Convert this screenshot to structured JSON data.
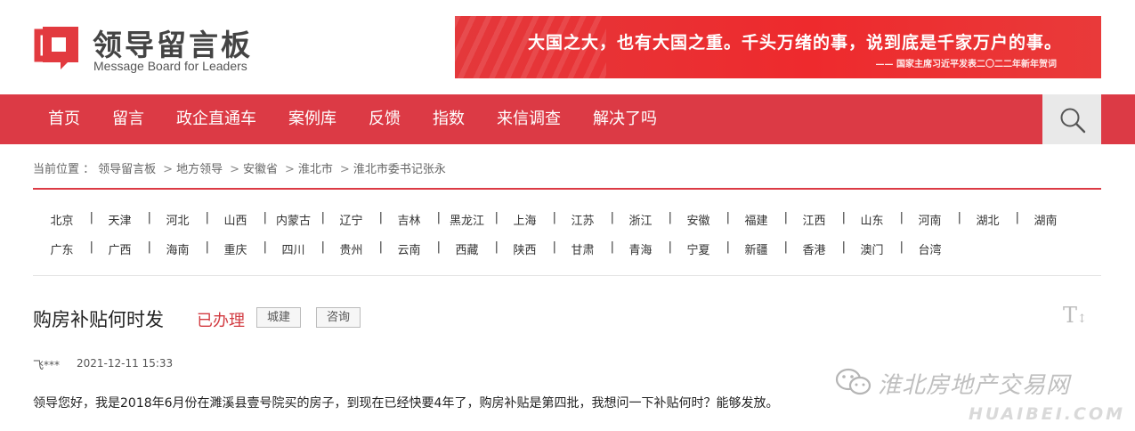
{
  "header": {
    "logo_title": "领导留言板",
    "logo_subtitle": "Message Board for Leaders",
    "banner_main": "大国之大，也有大国之重。千头万绪的事，说到底是千家万户的事。",
    "banner_sub": "—— 国家主席习近平发表二〇二二年新年贺词",
    "brand_color": "#dc3a45"
  },
  "nav": {
    "items": [
      "首页",
      "留言",
      "政企直通车",
      "案例库",
      "反馈",
      "指数",
      "来信调查",
      "解决了吗"
    ],
    "search_icon": "search-icon"
  },
  "breadcrumb": {
    "prefix": "当前位置 ：",
    "items": [
      "领导留言板",
      "地方领导",
      "安徽省",
      "淮北市",
      "淮北市委书记张永"
    ]
  },
  "regions": {
    "row1": [
      "北京",
      "天津",
      "河北",
      "山西",
      "内蒙古",
      "辽宁",
      "吉林",
      "黑龙江",
      "上海",
      "江苏",
      "浙江",
      "安徽",
      "福建",
      "江西",
      "山东",
      "河南",
      "湖北",
      "湖南"
    ],
    "row2": [
      "广东",
      "广西",
      "海南",
      "重庆",
      "四川",
      "贵州",
      "云南",
      "西藏",
      "陕西",
      "甘肃",
      "青海",
      "宁夏",
      "新疆",
      "香港",
      "澳门",
      "台湾"
    ]
  },
  "message": {
    "title": "购房补贴何时发",
    "status": "已办理",
    "tags": [
      "城建",
      "咨询"
    ],
    "font_toggle": "T",
    "author": "飞***",
    "time": "2021-12-11 15:33",
    "content": "领导您好，我是2018年6月份在濉溪县壹号院买的房子，到现在已经快要4年了，购房补贴是第四批，我想问一下补贴何时？能够发放。"
  },
  "watermark": {
    "text": "淮北房地产交易网",
    "domain": "HUAIBEI.COM",
    "icon": "wechat-icon"
  }
}
